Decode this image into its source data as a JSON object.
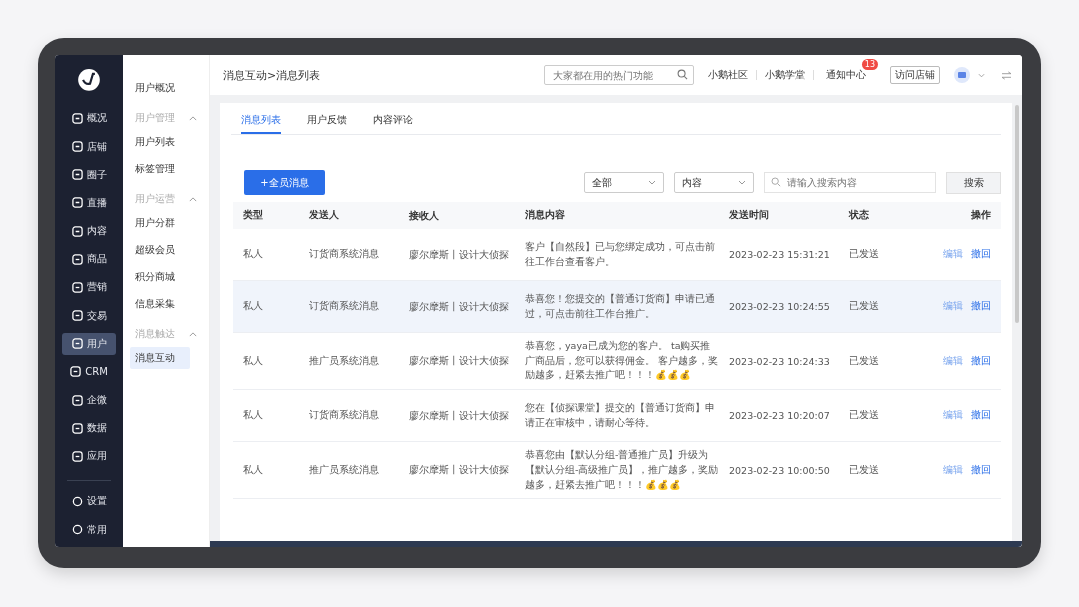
{
  "sidebar": {
    "items": [
      {
        "label": "概况",
        "selected": false
      },
      {
        "label": "店铺",
        "selected": false
      },
      {
        "label": "圈子",
        "selected": false
      },
      {
        "label": "直播",
        "selected": false
      },
      {
        "label": "内容",
        "selected": false
      },
      {
        "label": "商品",
        "selected": false
      },
      {
        "label": "营销",
        "selected": false
      },
      {
        "label": "交易",
        "selected": false
      },
      {
        "label": "用户",
        "selected": true
      },
      {
        "label": "CRM",
        "selected": false
      },
      {
        "label": "企微",
        "selected": false
      },
      {
        "label": "数据",
        "selected": false
      },
      {
        "label": "应用",
        "selected": false
      }
    ],
    "footer_items": [
      {
        "label": "设置"
      },
      {
        "label": "常用"
      }
    ]
  },
  "submenu": {
    "items": [
      {
        "kind": "link",
        "label": "用户概况",
        "selected": false
      },
      {
        "kind": "group",
        "label": "用户管理",
        "expanded": true
      },
      {
        "kind": "link",
        "label": "用户列表",
        "selected": false
      },
      {
        "kind": "link",
        "label": "标签管理",
        "selected": false
      },
      {
        "kind": "group",
        "label": "用户运营",
        "expanded": true
      },
      {
        "kind": "link",
        "label": "用户分群",
        "selected": false
      },
      {
        "kind": "link",
        "label": "超级会员",
        "selected": false
      },
      {
        "kind": "link",
        "label": "积分商城",
        "selected": false
      },
      {
        "kind": "link",
        "label": "信息采集",
        "selected": false
      },
      {
        "kind": "group",
        "label": "消息触达",
        "expanded": true
      },
      {
        "kind": "link",
        "label": "消息互动",
        "selected": true
      }
    ]
  },
  "header": {
    "breadcrumb": "消息互动>消息列表",
    "search": {
      "placeholder": "大家都在用的热门功能"
    },
    "links": [
      "小鹅社区",
      "小鹅学堂"
    ],
    "notifications": {
      "label": "通知中心",
      "badge": "13"
    },
    "visit_button": "访问店铺"
  },
  "tabs": [
    {
      "label": "消息列表",
      "selected": true
    },
    {
      "label": "用户反馈",
      "selected": false
    },
    {
      "label": "内容评论",
      "selected": false
    }
  ],
  "toolbar": {
    "add_button": "+全员消息",
    "filters": [
      {
        "value": "全部"
      },
      {
        "value": "内容"
      }
    ],
    "search": {
      "placeholder": "请输入搜索内容"
    },
    "search_button": "搜索"
  },
  "table": {
    "columns": [
      "类型",
      "发送人",
      "接收人",
      "消息内容",
      "发送时间",
      "状态",
      "操作"
    ],
    "rows": [
      {
        "type": "私人",
        "sender": "订货商系统消息",
        "receiver": "廖尔摩斯丨设计大侦探",
        "content": "客户【自然段】已与您绑定成功，可点击前往工作台查看客户。",
        "time": "2023-02-23 15:31:21",
        "status": "已发送",
        "actions": [
          "编辑",
          "撤回"
        ],
        "selected": false
      },
      {
        "type": "私人",
        "sender": "订货商系统消息",
        "receiver": "廖尔摩斯丨设计大侦探",
        "content": "恭喜您！您提交的【普通订货商】申请已通过，可点击前往工作台推广。",
        "time": "2023-02-23 10:24:55",
        "status": "已发送",
        "actions": [
          "编辑",
          "撤回"
        ],
        "selected": true
      },
      {
        "type": "私人",
        "sender": "推广员系统消息",
        "receiver": "廖尔摩斯丨设计大侦探",
        "content": "恭喜您，yaya已成为您的客户。 ta购买推广商品后，您可以获得佣金。 客户越多，奖励越多，赶紧去推广吧！！！💰💰💰",
        "time": "2023-02-23 10:24:33",
        "status": "已发送",
        "actions": [
          "编辑",
          "撤回"
        ],
        "selected": false
      },
      {
        "type": "私人",
        "sender": "订货商系统消息",
        "receiver": "廖尔摩斯丨设计大侦探",
        "content": "您在【侦探课堂】提交的【普通订货商】申请正在审核中，请耐心等待。",
        "time": "2023-02-23 10:20:07",
        "status": "已发送",
        "actions": [
          "编辑",
          "撤回"
        ],
        "selected": false
      },
      {
        "type": "私人",
        "sender": "推广员系统消息",
        "receiver": "廖尔摩斯丨设计大侦探",
        "content": "恭喜您由【默认分组-普通推广员】升级为【默认分组-高级推广员】，推广越多，奖励越多，赶紧去推广吧！！！💰💰💰",
        "time": "2023-02-23 10:00:50",
        "status": "已发送",
        "actions": [
          "编辑",
          "撤回"
        ],
        "selected": false
      }
    ]
  }
}
